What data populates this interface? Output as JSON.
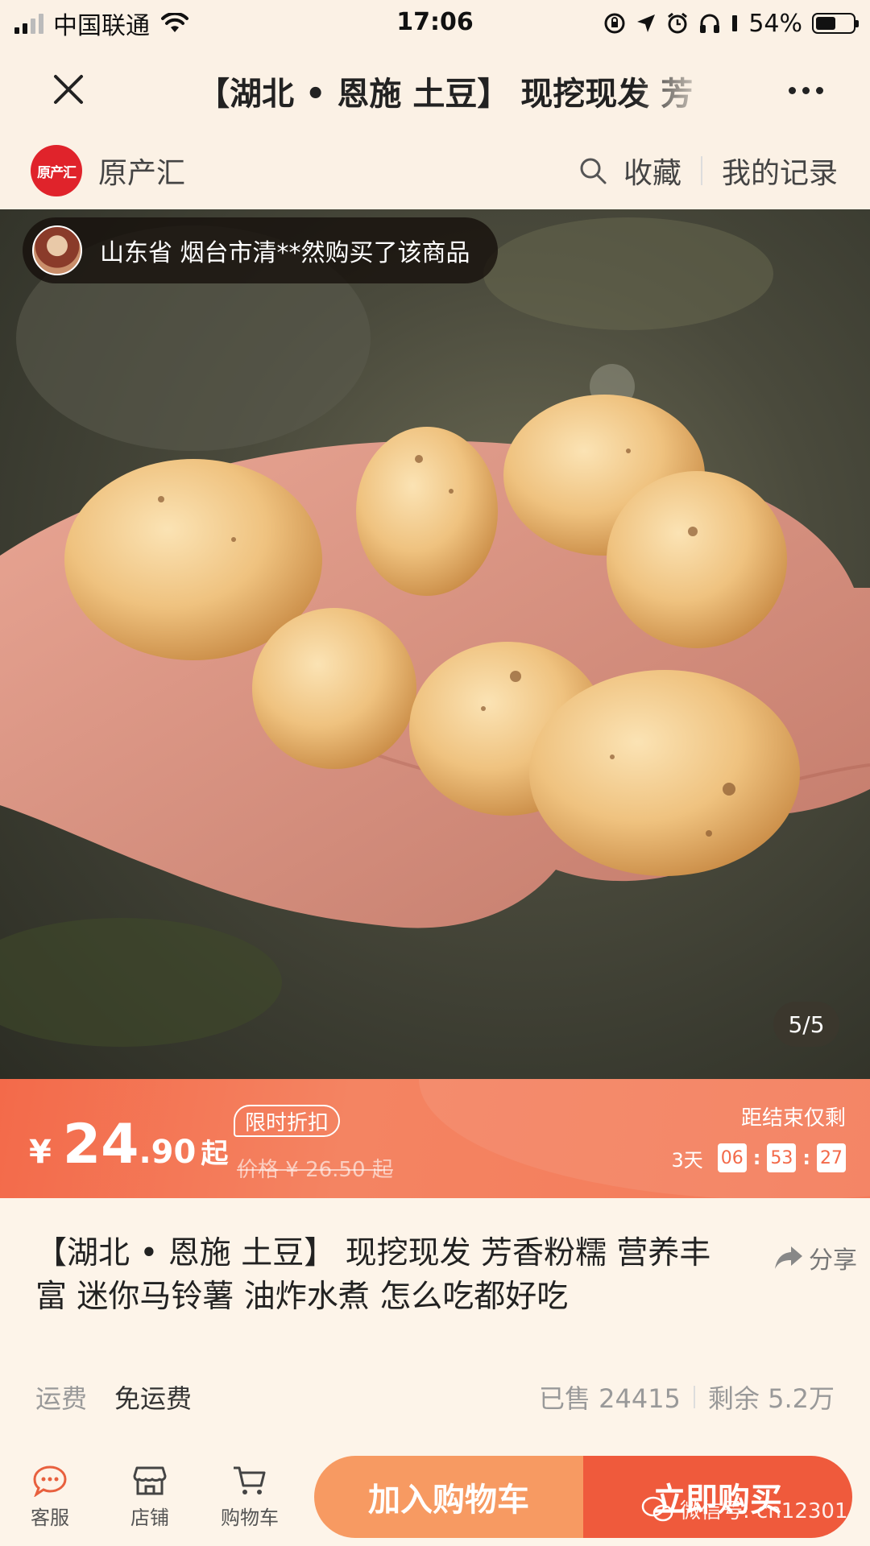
{
  "status_bar": {
    "carrier": "中国联通",
    "time": "17:06",
    "battery": "54%",
    "battery_level": 0.54
  },
  "header": {
    "title": "【湖北 • 恩施 土豆】 现挖现发 芳"
  },
  "store": {
    "logo_text": "原产汇",
    "name": "原产汇",
    "favorite_label": "收藏",
    "records_label": "我的记录"
  },
  "hero": {
    "purchase_notice": "山东省 烟台市清**然购买了该商品",
    "image_counter": "5/5"
  },
  "price": {
    "currency": "¥",
    "integer": "24",
    "decimal": ".90",
    "suffix": "起",
    "discount_tag": "限时折扣",
    "original": "价格 ¥ 26.50 起",
    "countdown_label": "距结束仅剩",
    "days": "3天",
    "hours": "06",
    "minutes": "53",
    "seconds": "27"
  },
  "product": {
    "title": "【湖北 • 恩施 土豆】 现挖现发 芳香粉糯 营养丰富 迷你马铃薯 油炸水煮 怎么吃都好吃",
    "share_label": "分享",
    "shipping_label": "运费",
    "shipping_value": "免运费",
    "sold": "已售 24415",
    "remaining": "剩余 5.2万"
  },
  "bottom_nav": {
    "service": "客服",
    "shop": "店铺",
    "cart": "购物车",
    "add_to_cart": "加入购物车",
    "buy_now": "立即购买"
  },
  "watermark": "微信号: cn12301",
  "colors": {
    "background": "#fbf1e5",
    "brand_red": "#e0232b",
    "price_banner": "#f36a4a",
    "cart_button": "#f79a62",
    "buy_button": "#ef5a3c"
  }
}
